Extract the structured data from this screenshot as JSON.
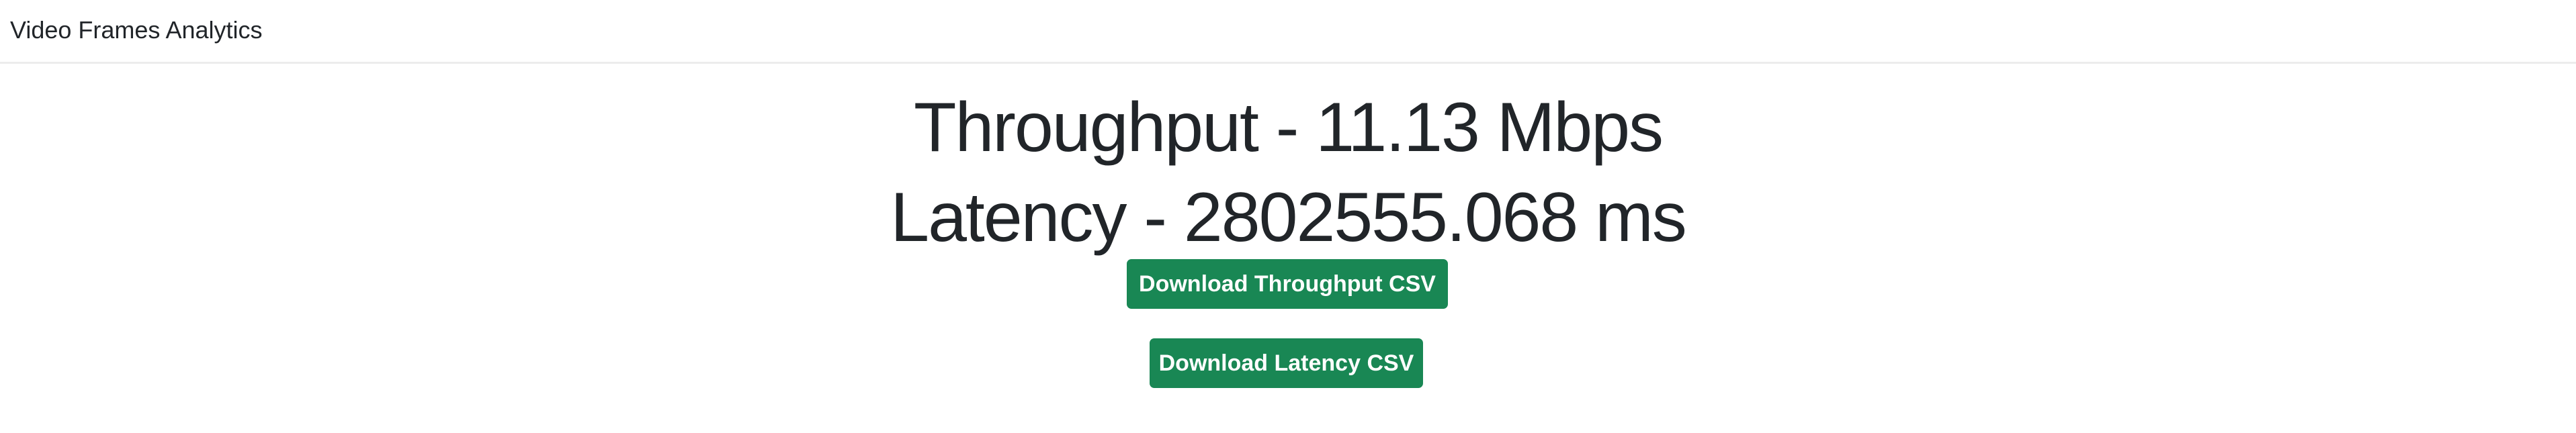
{
  "navbar": {
    "brand": "Video Frames Analytics"
  },
  "metrics": {
    "throughput": "Throughput - 11.13 Mbps",
    "latency": "Latency - 2802555.068 ms"
  },
  "buttons": {
    "download_throughput": "Download Throughput CSV",
    "download_latency": "Download Latency CSV"
  },
  "colors": {
    "button": "#198754"
  }
}
